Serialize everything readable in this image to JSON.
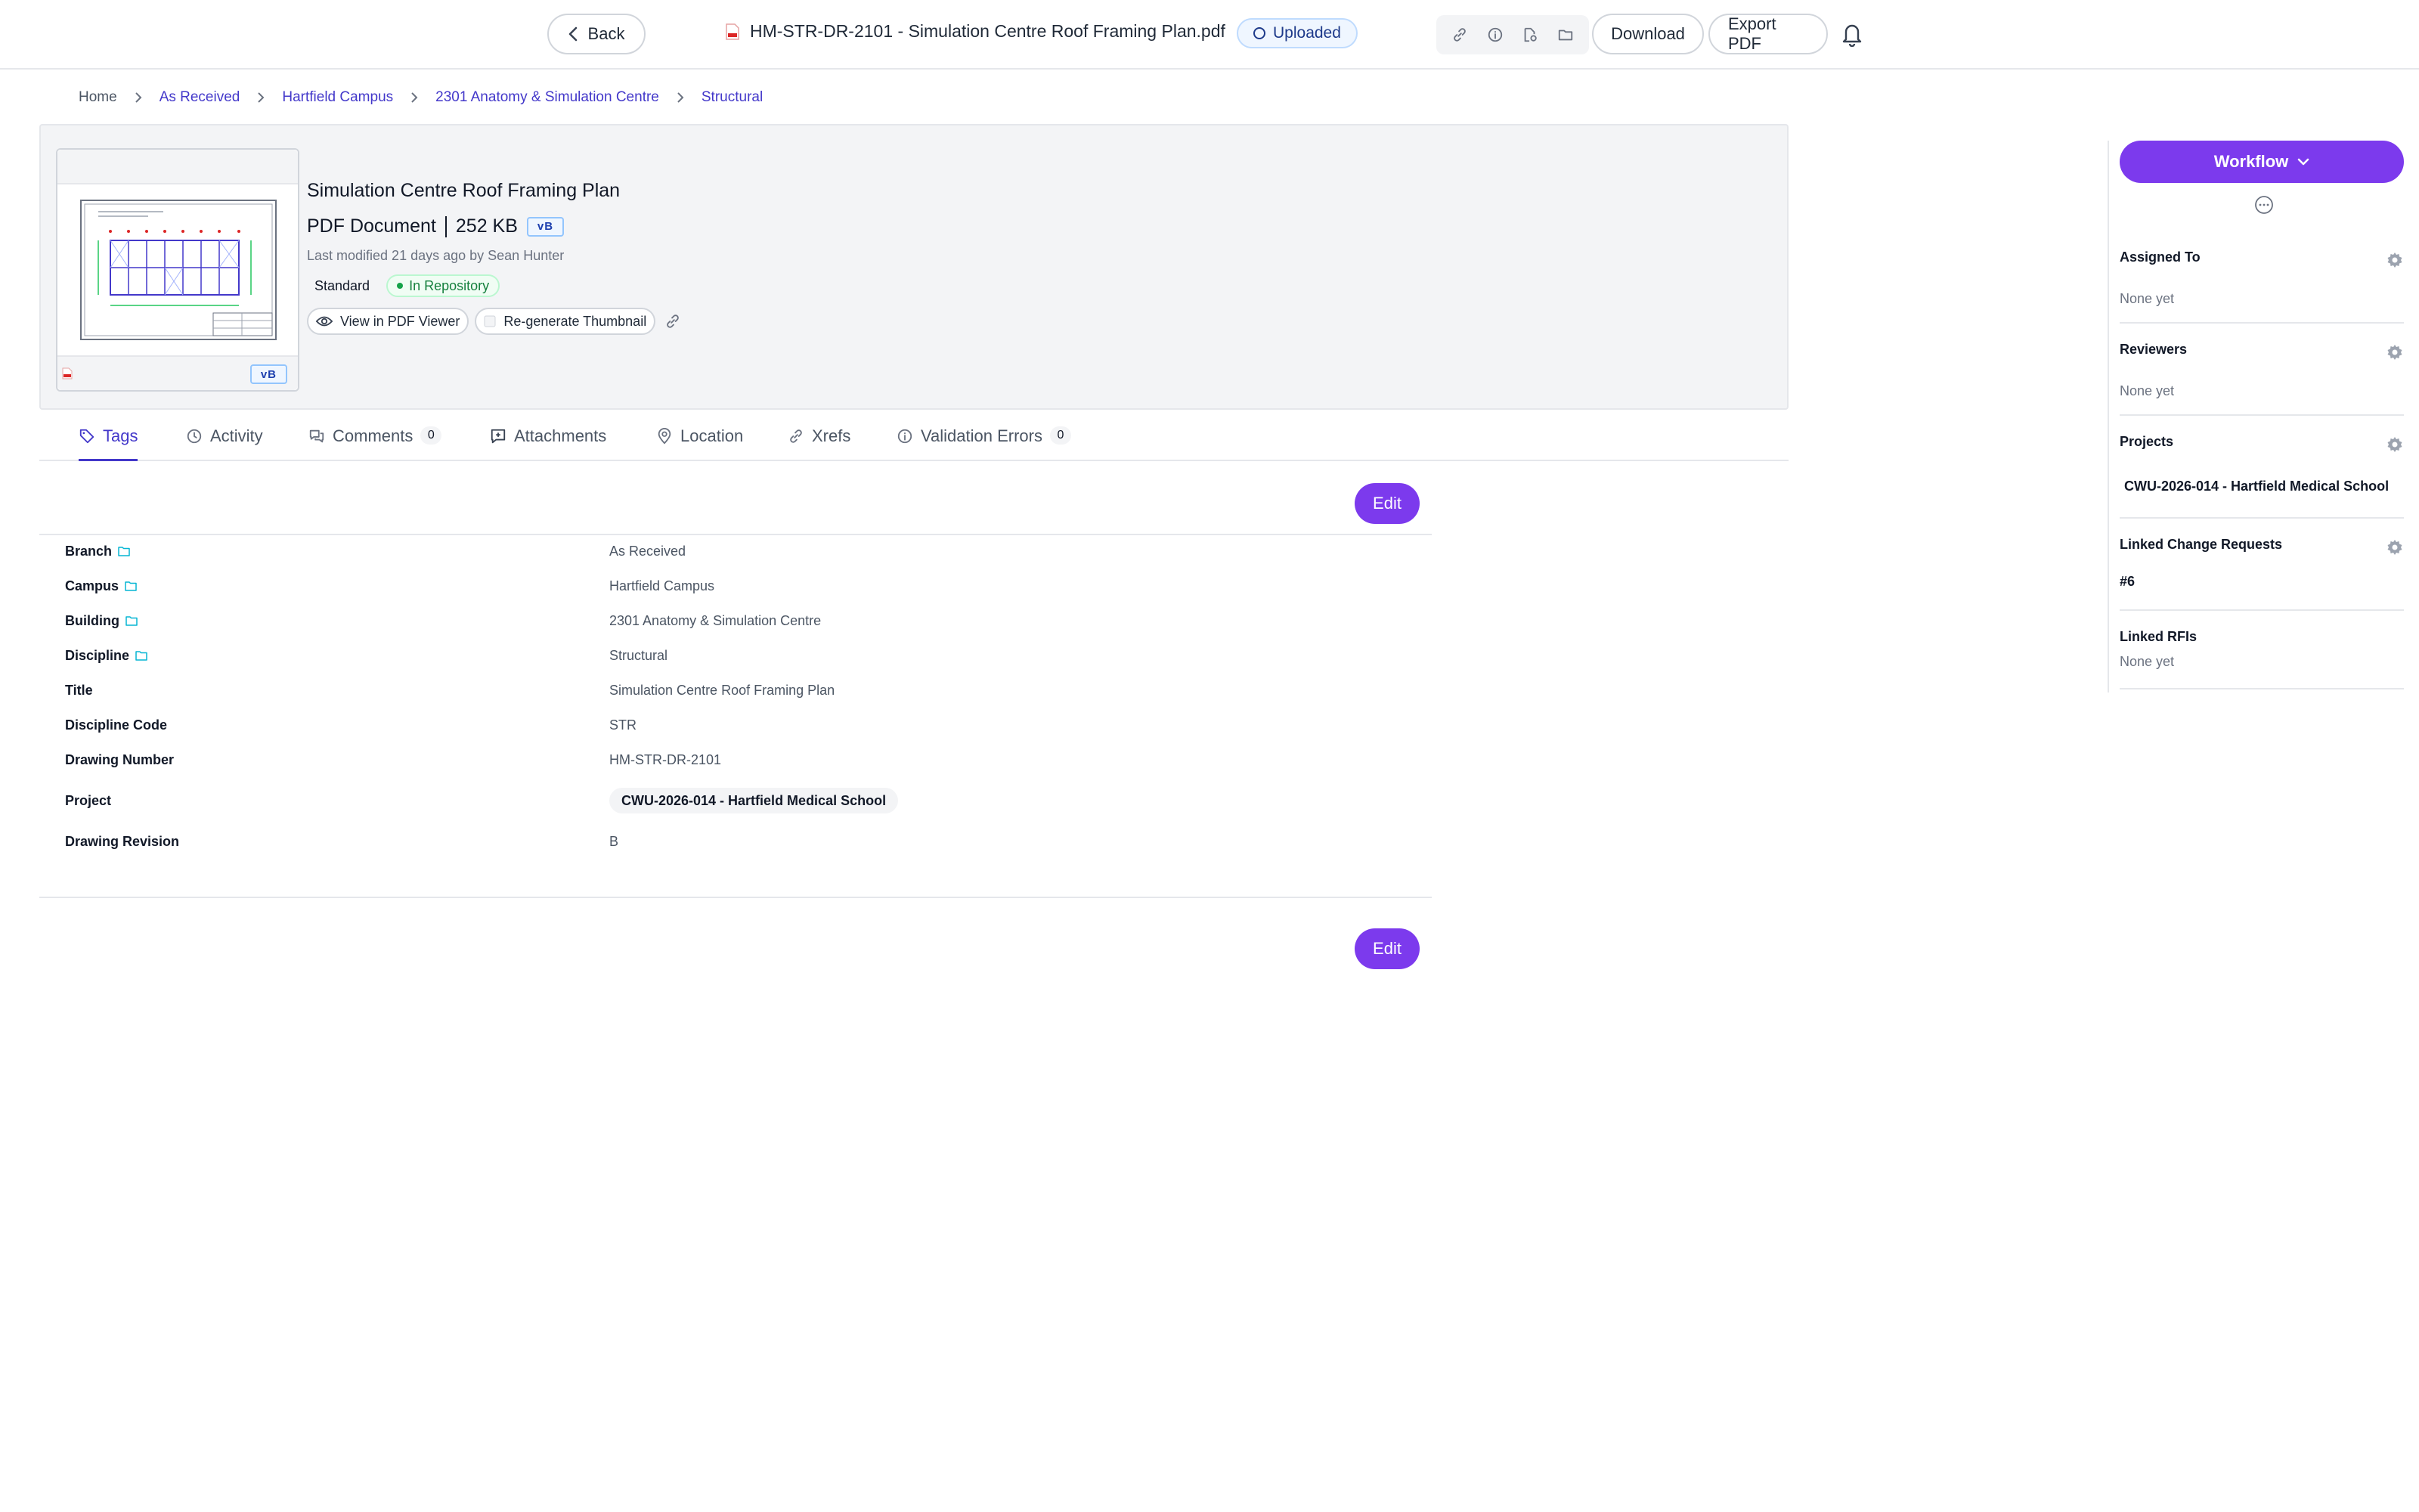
{
  "header": {
    "back_label": "Back",
    "file_name": "HM-STR-DR-2101 - Simulation Centre Roof Framing Plan.pdf",
    "status": "Uploaded",
    "download_label": "Download",
    "export_label": "Export PDF"
  },
  "breadcrumb": [
    "Home",
    "As Received",
    "Hartfield Campus",
    "2301 Anatomy & Simulation Centre",
    "Structural"
  ],
  "file": {
    "title": "Simulation Centre Roof Framing Plan",
    "type": "PDF Document",
    "size": "252 KB",
    "version": "vB",
    "modified": "Last modified 21 days ago by Sean Hunter",
    "tag_standard": "Standard",
    "tag_repo": "In Repository",
    "view_label": "View in PDF Viewer",
    "regen_label": "Re-generate Thumbnail"
  },
  "tabs": [
    {
      "label": "Tags",
      "icon": "tag-icon"
    },
    {
      "label": "Activity",
      "icon": "clock-icon"
    },
    {
      "label": "Comments",
      "icon": "comments-icon",
      "count": "0"
    },
    {
      "label": "Attachments",
      "icon": "attachment-icon"
    },
    {
      "label": "Location",
      "icon": "location-pin-icon"
    },
    {
      "label": "Xrefs",
      "icon": "link-icon"
    },
    {
      "label": "Validation Errors",
      "icon": "info-icon",
      "count": "0"
    }
  ],
  "edit_label": "Edit",
  "fields": [
    {
      "key": "Branch",
      "value": "As Received",
      "folder": true
    },
    {
      "key": "Campus",
      "value": "Hartfield Campus",
      "folder": true
    },
    {
      "key": "Building",
      "value": "2301 Anatomy & Simulation Centre",
      "folder": true
    },
    {
      "key": "Discipline",
      "value": "Structural",
      "folder": true
    },
    {
      "key": "Title",
      "value": "Simulation Centre Roof Framing Plan"
    },
    {
      "key": "Discipline Code",
      "value": "STR"
    },
    {
      "key": "Drawing Number",
      "value": "HM-STR-DR-2101"
    },
    {
      "key": "Project",
      "value": "CWU-2026-014 - Hartfield Medical School",
      "chip": true
    },
    {
      "key": "Drawing Revision",
      "value": "B"
    }
  ],
  "sidebar": {
    "workflow_label": "Workflow",
    "assigned_to": {
      "title": "Assigned To",
      "value": "None yet"
    },
    "reviewers": {
      "title": "Reviewers",
      "value": "None yet"
    },
    "projects": {
      "title": "Projects",
      "value": "CWU-2026-014 - Hartfield Medical School"
    },
    "linked_change_requests": {
      "title": "Linked Change Requests",
      "value": "#6"
    },
    "linked_rfis": {
      "title": "Linked RFIs",
      "value": "None yet"
    }
  },
  "colors": {
    "accent": "#7c3aed",
    "link": "#4338ca",
    "status_green": "#15803d",
    "uploaded_blue": "#1e3a8a"
  }
}
